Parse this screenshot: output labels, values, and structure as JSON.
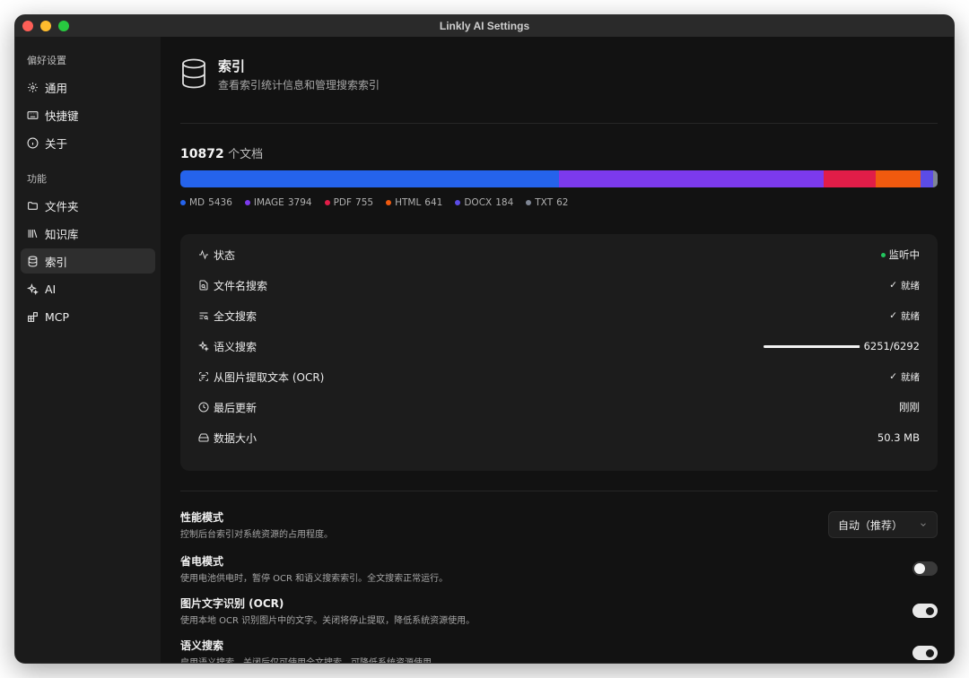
{
  "window": {
    "title": "Linkly AI Settings"
  },
  "sidebar": {
    "section_prefs": "偏好设置",
    "prefs": [
      {
        "label": "通用",
        "icon": "gear-icon"
      },
      {
        "label": "快捷键",
        "icon": "keyboard-icon"
      },
      {
        "label": "关于",
        "icon": "info-icon"
      }
    ],
    "section_features": "功能",
    "features": [
      {
        "label": "文件夹",
        "icon": "folder-icon"
      },
      {
        "label": "知识库",
        "icon": "library-icon"
      },
      {
        "label": "索引",
        "icon": "database-icon",
        "active": true
      },
      {
        "label": "AI",
        "icon": "sparkles-icon"
      },
      {
        "label": "MCP",
        "icon": "blocks-icon"
      }
    ]
  },
  "header": {
    "title": "索引",
    "subtitle": "查看索引统计信息和管理搜索索引"
  },
  "docs": {
    "total": "10872",
    "unit": "个文档"
  },
  "breakdown": [
    {
      "label": "MD",
      "count": "5436",
      "value": 5436,
      "color": "#2563eb"
    },
    {
      "label": "IMAGE",
      "count": "3794",
      "value": 3794,
      "color": "#7c3aed"
    },
    {
      "label": "PDF",
      "count": "755",
      "value": 755,
      "color": "#e11d48"
    },
    {
      "label": "HTML",
      "count": "641",
      "value": 641,
      "color": "#f05a0f"
    },
    {
      "label": "DOCX",
      "count": "184",
      "value": 184,
      "color": "#5b4ce6"
    },
    {
      "label": "TXT",
      "count": "62",
      "value": 62,
      "color": "#7f8694"
    }
  ],
  "status": {
    "status_label": "状态",
    "status_value": "监听中",
    "filename_label": "文件名搜索",
    "filename_value": "就绪",
    "fulltext_label": "全文搜索",
    "fulltext_value": "就绪",
    "semantic_label": "语义搜索",
    "semantic_progress": "6251/6292",
    "semantic_fraction": 0.9935,
    "ocr_label": "从图片提取文本 (OCR)",
    "ocr_value": "就绪",
    "updated_label": "最后更新",
    "updated_value": "刚刚",
    "size_label": "数据大小",
    "size_value": "50.3 MB"
  },
  "settings": {
    "performance": {
      "title": "性能模式",
      "desc": "控制后台索引对系统资源的占用程度。",
      "value": "自动（推荐）"
    },
    "power": {
      "title": "省电模式",
      "desc": "使用电池供电时，暂停 OCR 和语义搜索索引。全文搜索正常运行。",
      "on": false
    },
    "ocr": {
      "title": "图片文字识别 (OCR)",
      "desc": "使用本地 OCR 识别图片中的文字。关闭将停止提取，降低系统资源使用。",
      "on": true
    },
    "semantic": {
      "title": "语义搜索",
      "desc": "启用语义搜索。关闭后仅可使用全文搜索，可降低系统资源使用。",
      "on": true
    }
  }
}
